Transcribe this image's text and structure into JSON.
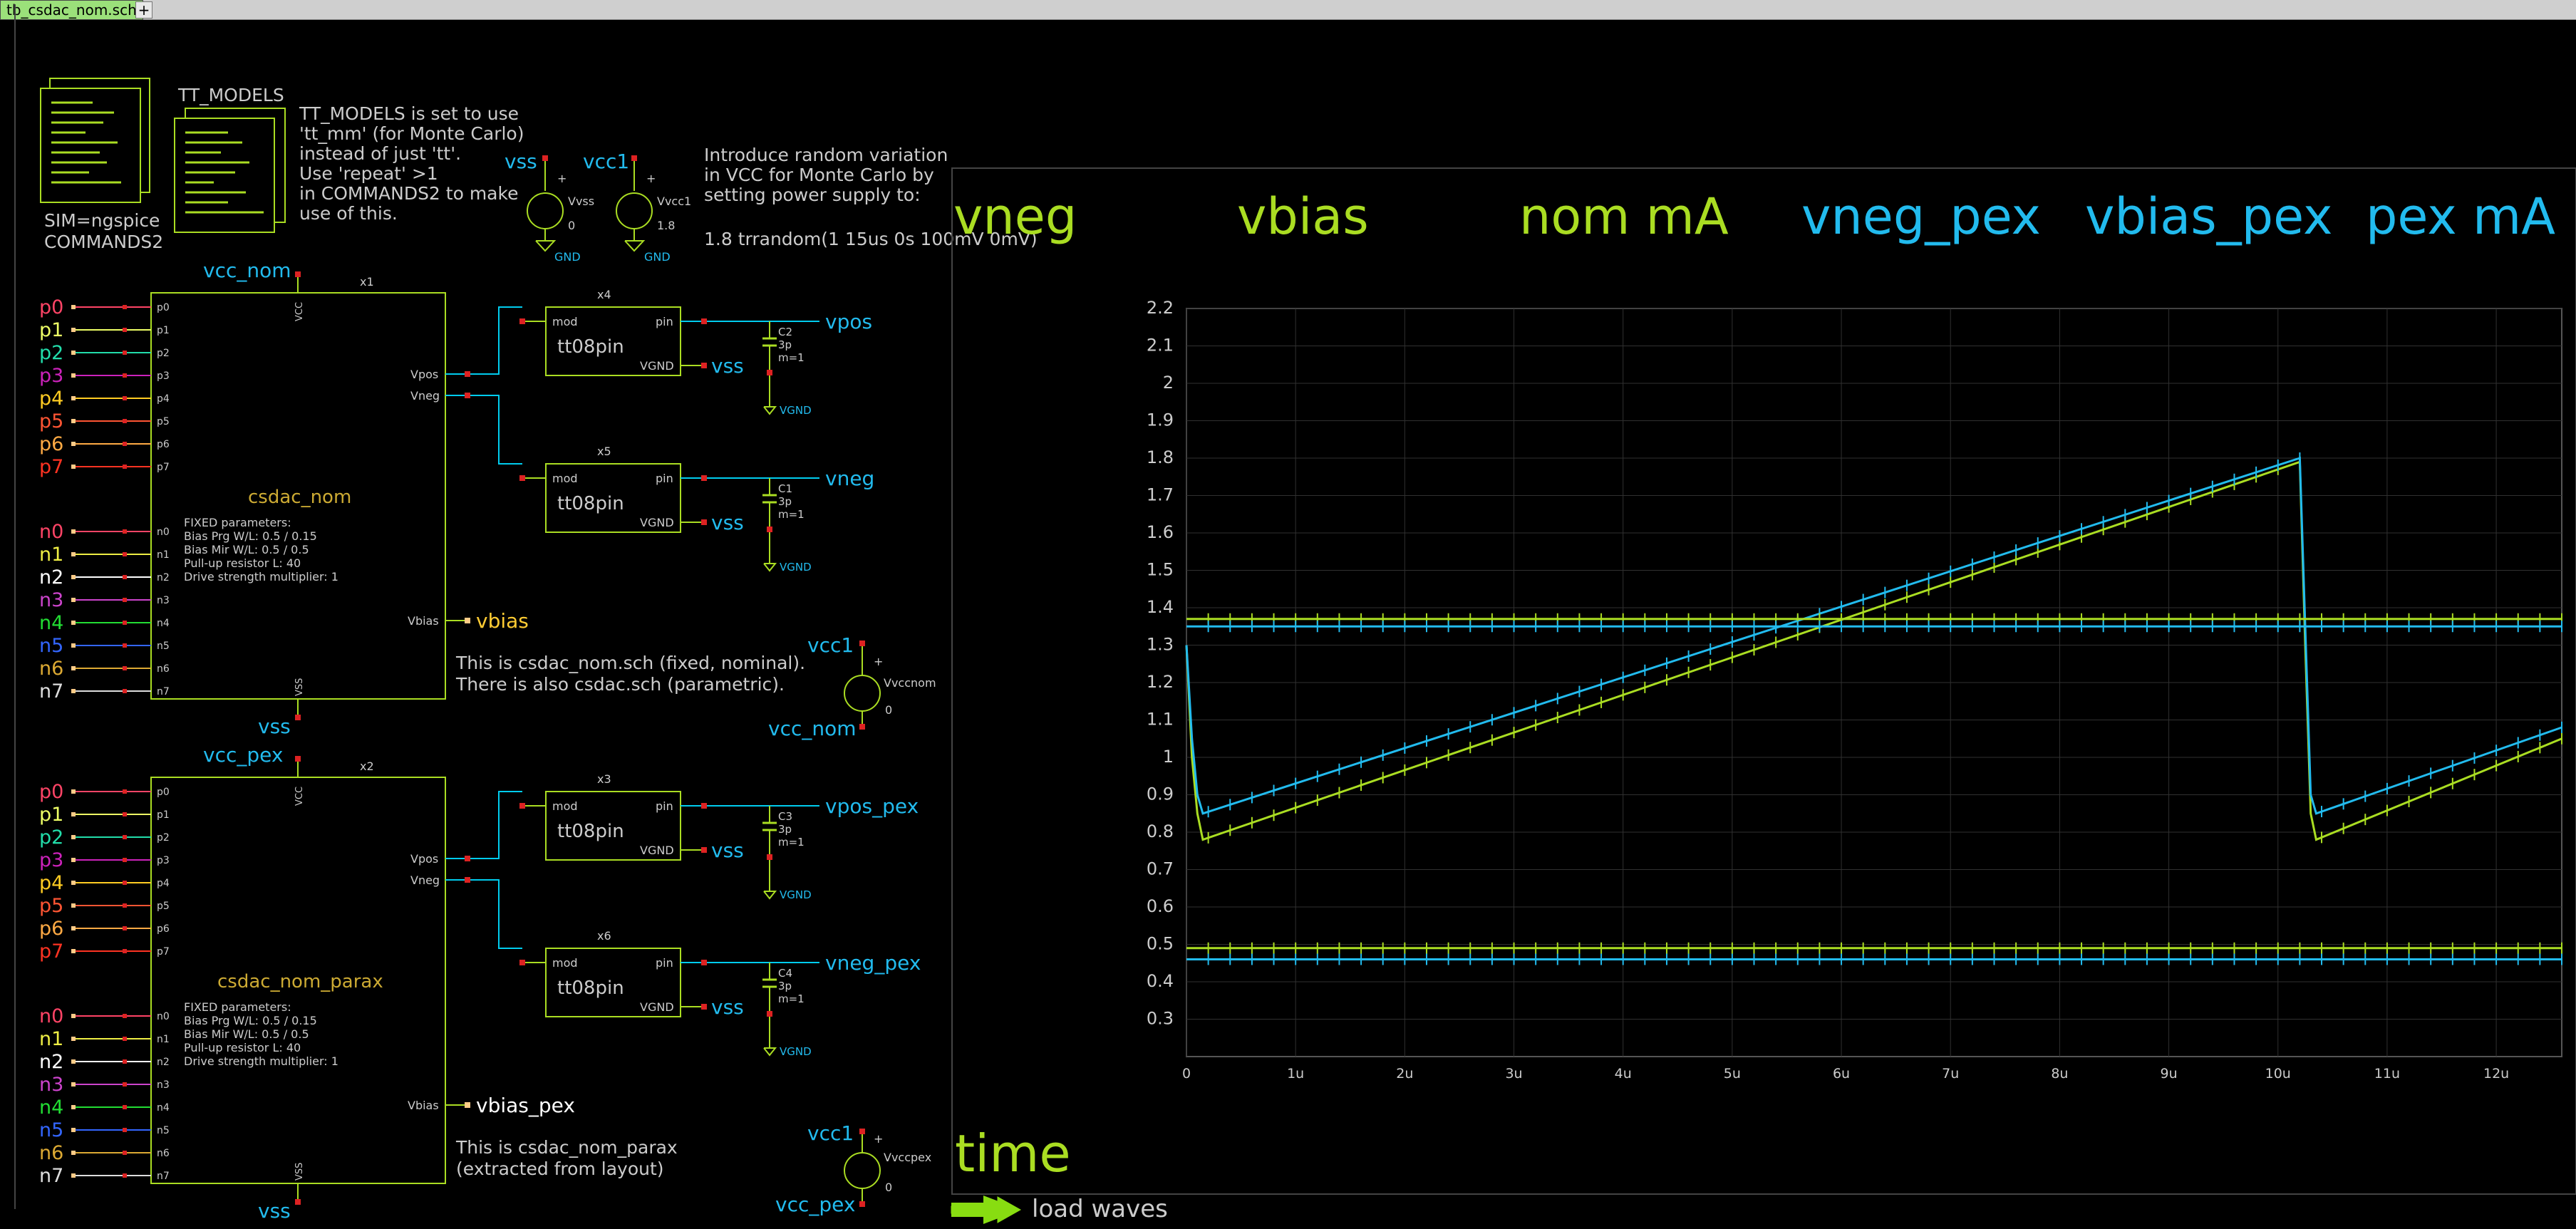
{
  "tab": {
    "label": "tb_csdac_nom.sch",
    "add_label": "+"
  },
  "colors": {
    "wire": "#00ccee",
    "device": "#aadd22",
    "pin": "#dd2222",
    "text": "#cccccc",
    "p0": "#ff4466",
    "p1": "#eeff66",
    "p2": "#22ddaa",
    "p3": "#cc22bb",
    "p4": "#ffcc22",
    "p5": "#ff5533",
    "p6": "#ffaa44",
    "p7": "#ff3322",
    "n0": "#ff4466",
    "n1": "#eeee44",
    "n2": "#ffffff",
    "n3": "#cc44cc",
    "n4": "#22dd33",
    "n5": "#3366ff",
    "n6": "#ddaa33",
    "n7": "#dddddd",
    "trace_nom": "#aadd22",
    "trace_pex": "#22bbee",
    "grid": "#303030"
  },
  "commands": {
    "line1": "SIM=ngspice",
    "line2": "COMMANDS2"
  },
  "models": {
    "title": "TT_MODELS",
    "note": [
      "TT_MODELS is set to use",
      "'tt_mm' (for Monte Carlo)",
      "instead of just 'tt'.",
      "Use 'repeat' >1",
      "in COMMANDS2 to make",
      "use of this."
    ]
  },
  "sources": {
    "vss_label": "vss",
    "vss_name": "Vvss",
    "vss_value": "0",
    "vcc1_label": "vcc1",
    "vcc1_name": "Vvcc1",
    "vcc1_value": "1.8",
    "gnd": "GND",
    "vccnom_name": "Vvccnom",
    "vccnom_value": "0",
    "vccnom_top": "vcc1",
    "vccnom_bottom": "vcc_nom",
    "vccpex_name": "Vvccpex",
    "vccpex_value": "0",
    "vccpex_top": "vcc1",
    "vccpex_bottom": "vcc_pex"
  },
  "mc_note": [
    "Introduce random variation",
    "in VCC for Monte Carlo by",
    "setting power supply to:",
    "",
    "1.8 trrandom(1 15us 0s 100mV 0mV)"
  ],
  "pins_p": [
    "p0",
    "p1",
    "p2",
    "p3",
    "p4",
    "p5",
    "p6",
    "p7"
  ],
  "pins_n": [
    "n0",
    "n1",
    "n2",
    "n3",
    "n4",
    "n5",
    "n6",
    "n7"
  ],
  "dac_nom": {
    "inst": "x1",
    "name": "csdac_nom",
    "vcc_label": "vcc_nom",
    "vss_label": "vss",
    "vcc_pin": "VCC",
    "vss_pin": "VSS",
    "vpos_pin": "Vpos",
    "vneg_pin": "Vneg",
    "vbias_pin": "Vbias",
    "vbias_label": "vbias",
    "params": [
      "FIXED parameters:",
      "Bias Prg W/L: 0.5 / 0.15",
      "Bias Mir W/L: 0.5 / 0.5",
      "Pull-up resistor L: 40",
      "Drive strength multiplier: 1"
    ],
    "note": [
      "This is csdac_nom.sch (fixed, nominal).",
      "There is also csdac.sch (parametric)."
    ]
  },
  "dac_pex": {
    "inst": "x2",
    "name": "csdac_nom_parax",
    "vcc_label": "vcc_pex",
    "vss_label": "vss",
    "vcc_pin": "VCC",
    "vss_pin": "VSS",
    "vpos_pin": "Vpos",
    "vneg_pin": "Vneg",
    "vbias_pin": "Vbias",
    "vbias_label": "vbias_pex",
    "params": [
      "FIXED parameters:",
      "Bias Prg W/L: 0.5 / 0.15",
      "Bias Mir W/L: 0.5 / 0.5",
      "Pull-up resistor L: 40",
      "Drive strength multiplier: 1"
    ],
    "note": [
      "This is csdac_nom_parax",
      "(extracted from layout)"
    ]
  },
  "pads": [
    {
      "inst": "x4",
      "name": "tt08pin",
      "mod": "mod",
      "pin": "pin",
      "vgnd": "VGND",
      "vss": "vss",
      "cap": "C2",
      "cap_val": "3p",
      "cap_m": "m=1",
      "out": "vpos",
      "capgnd": "VGND"
    },
    {
      "inst": "x5",
      "name": "tt08pin",
      "mod": "mod",
      "pin": "pin",
      "vgnd": "VGND",
      "vss": "vss",
      "cap": "C1",
      "cap_val": "3p",
      "cap_m": "m=1",
      "out": "vneg",
      "capgnd": "VGND"
    },
    {
      "inst": "x3",
      "name": "tt08pin",
      "mod": "mod",
      "pin": "pin",
      "vgnd": "VGND",
      "vss": "vss",
      "cap": "C3",
      "cap_val": "3p",
      "cap_m": "m=1",
      "out": "vpos_pex",
      "capgnd": "VGND"
    },
    {
      "inst": "x6",
      "name": "tt08pin",
      "mod": "mod",
      "pin": "pin",
      "vgnd": "VGND",
      "vss": "vss",
      "cap": "C4",
      "cap_val": "3p",
      "cap_m": "m=1",
      "out": "vneg_pex",
      "capgnd": "VGND"
    }
  ],
  "graph": {
    "xlabel": "time",
    "load_label": "load waves"
  },
  "chart_data": {
    "type": "line",
    "legend": [
      {
        "name": "vneg",
        "color": "#aadd22"
      },
      {
        "name": "vbias",
        "color": "#aadd22"
      },
      {
        "name": "nom mA",
        "color": "#aadd22"
      },
      {
        "name": "vneg_pex",
        "color": "#22bbee"
      },
      {
        "name": "vbias_pex",
        "color": "#22bbee"
      },
      {
        "name": "pex mA",
        "color": "#22bbee"
      }
    ],
    "xlabel": "time",
    "xlim": [
      0,
      12.6
    ],
    "ylim": [
      0.2,
      2.2
    ],
    "x_ticks": [
      "0",
      "1u",
      "2u",
      "3u",
      "4u",
      "5u",
      "6u",
      "7u",
      "8u",
      "9u",
      "10u",
      "11u",
      "12u"
    ],
    "x_tick_values": [
      0,
      1,
      2,
      3,
      4,
      5,
      6,
      7,
      8,
      9,
      10,
      11,
      12
    ],
    "y_ticks": [
      "0.3",
      "0.4",
      "0.5",
      "0.6",
      "0.7",
      "0.8",
      "0.9",
      "1",
      "1.1",
      "1.2",
      "1.3",
      "1.4",
      "1.5",
      "1.6",
      "1.7",
      "1.8",
      "1.9",
      "2",
      "2.1",
      "2.2"
    ],
    "y_tick_values": [
      0.3,
      0.4,
      0.5,
      0.6,
      0.7,
      0.8,
      0.9,
      1.0,
      1.1,
      1.2,
      1.3,
      1.4,
      1.5,
      1.6,
      1.7,
      1.8,
      1.9,
      2.0,
      2.1,
      2.2
    ],
    "grid": true,
    "series": [
      {
        "name": "vneg",
        "color": "#aadd22",
        "x": [
          0,
          0.05,
          0.1,
          0.15,
          10.2,
          10.25,
          10.3,
          10.35,
          12.6
        ],
        "y": [
          1.3,
          1.0,
          0.85,
          0.78,
          1.79,
          1.3,
          0.85,
          0.78,
          1.05
        ]
      },
      {
        "name": "vneg_pex",
        "color": "#22bbee",
        "x": [
          0,
          0.05,
          0.1,
          0.15,
          10.2,
          10.25,
          10.3,
          10.35,
          12.6
        ],
        "y": [
          1.3,
          1.05,
          0.9,
          0.85,
          1.8,
          1.35,
          0.9,
          0.85,
          1.08
        ]
      },
      {
        "name": "vbias",
        "color": "#aadd22",
        "x": [
          0,
          12.6
        ],
        "y": [
          1.37,
          1.37
        ]
      },
      {
        "name": "vbias_pex",
        "color": "#22bbee",
        "x": [
          0,
          12.6
        ],
        "y": [
          1.35,
          1.35
        ]
      },
      {
        "name": "nom mA",
        "color": "#aadd22",
        "x": [
          0,
          12.6
        ],
        "y": [
          0.49,
          0.49
        ]
      },
      {
        "name": "pex mA",
        "color": "#22bbee",
        "x": [
          0,
          12.6
        ],
        "y": [
          0.46,
          0.46
        ]
      }
    ]
  }
}
